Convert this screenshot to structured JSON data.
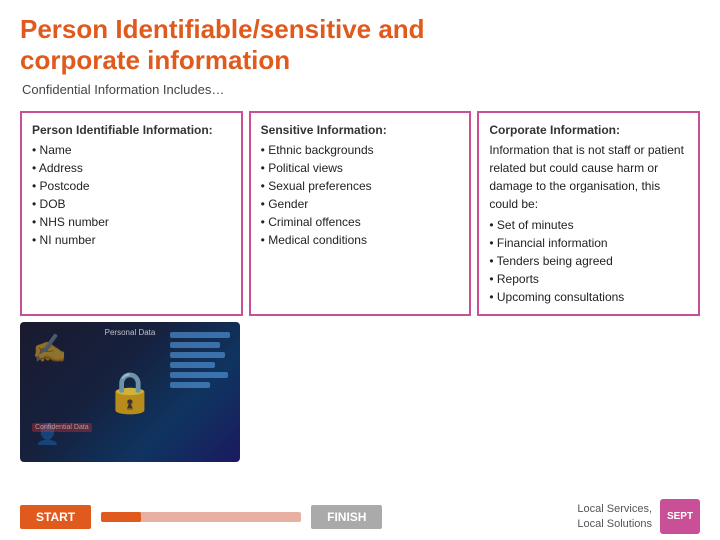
{
  "header": {
    "title_line1": "Person Identifiable/sensitive and",
    "title_line2": "corporate information",
    "subtitle": "Confidential Information Includes…"
  },
  "columns": [
    {
      "id": "person-identifiable",
      "title": "Person Identifiable Information:",
      "items": [
        "Name",
        "Address",
        "Postcode",
        "DOB",
        "NHS number",
        "NI number"
      ]
    },
    {
      "id": "sensitive",
      "title": "Sensitive Information:",
      "items": [
        "Ethnic backgrounds",
        "Political views",
        "Sexual preferences",
        "Gender",
        "Criminal offences",
        "Medical conditions"
      ]
    },
    {
      "id": "corporate",
      "title": "Corporate Information:",
      "description": "Information that is not staff or patient related but could cause harm or damage to the organisation, this could be:",
      "items": [
        "Set of minutes",
        "Financial information",
        "Tenders being agreed",
        "Reports",
        "Upcoming consultations"
      ]
    }
  ],
  "image": {
    "personal_data_label": "Personal Data",
    "conf_label": "Confidential Data"
  },
  "footer": {
    "start_label": "START",
    "finish_label": "FINISH",
    "local_services_line1": "Local Services,",
    "local_services_line2": "Local Solutions",
    "sept_label": "SEPT"
  }
}
